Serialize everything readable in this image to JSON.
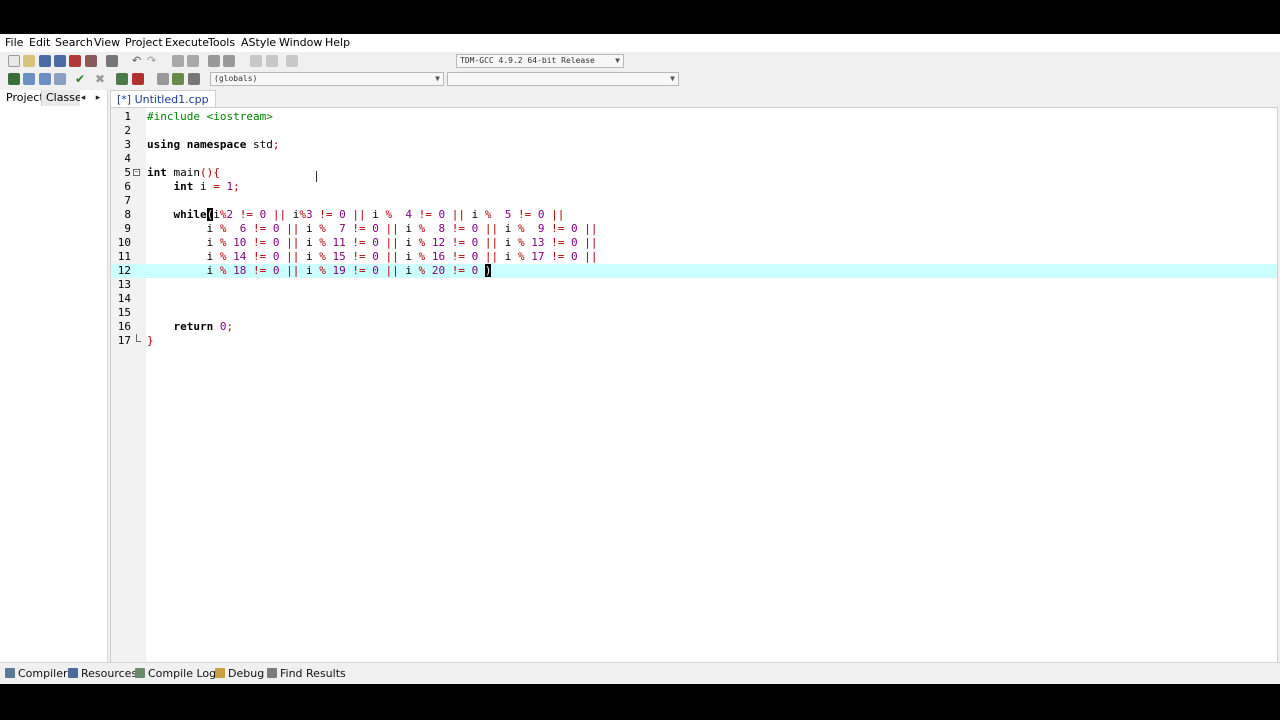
{
  "menu": [
    "File",
    "Edit",
    "Search",
    "View",
    "Project",
    "Execute",
    "Tools",
    "AStyle",
    "Window",
    "Help"
  ],
  "toolbar": {
    "compiler_select": "TDM-GCC 4.9.2 64-bit Release",
    "scope_select": "(globals)",
    "member_select": ""
  },
  "left_panel": {
    "tabs": [
      "Project",
      "Classes"
    ],
    "prev_arrow": "◂",
    "next_arrow": "▸"
  },
  "editor": {
    "file_tab": "[*] Untitled1.cpp",
    "current_line": 12,
    "lines": [
      {
        "n": "1",
        "text": "#include <iostream>"
      },
      {
        "n": "2",
        "text": ""
      },
      {
        "n": "3",
        "text": "using namespace std;"
      },
      {
        "n": "4",
        "text": ""
      },
      {
        "n": "5",
        "text": "int main(){"
      },
      {
        "n": "6",
        "text": "    int i = 1;"
      },
      {
        "n": "7",
        "text": ""
      },
      {
        "n": "8",
        "text": "    while(i%2 != 0 || i%3 != 0 || i %  4 != 0 || i %  5 != 0 ||"
      },
      {
        "n": "9",
        "text": "         i %  6 != 0 || i %  7 != 0 || i %  8 != 0 || i %  9 != 0 ||"
      },
      {
        "n": "10",
        "text": "         i % 10 != 0 || i % 11 != 0 || i % 12 != 0 || i % 13 != 0 ||"
      },
      {
        "n": "11",
        "text": "         i % 14 != 0 || i % 15 != 0 || i % 16 != 0 || i % 17 != 0 ||"
      },
      {
        "n": "12",
        "text": "         i % 18 != 0 || i % 19 != 0 || i % 20 != 0 )"
      },
      {
        "n": "13",
        "text": ""
      },
      {
        "n": "14",
        "text": ""
      },
      {
        "n": "15",
        "text": ""
      },
      {
        "n": "16",
        "text": "    return 0;"
      },
      {
        "n": "17",
        "text": "}"
      }
    ]
  },
  "bottom_tabs": [
    "Compiler",
    "Resources",
    "Compile Log",
    "Debug",
    "Find Results"
  ],
  "colors": {
    "current_line": "#ccffff",
    "preprocessor": "#008000",
    "operator": "#aa0000",
    "number": "#800080"
  }
}
